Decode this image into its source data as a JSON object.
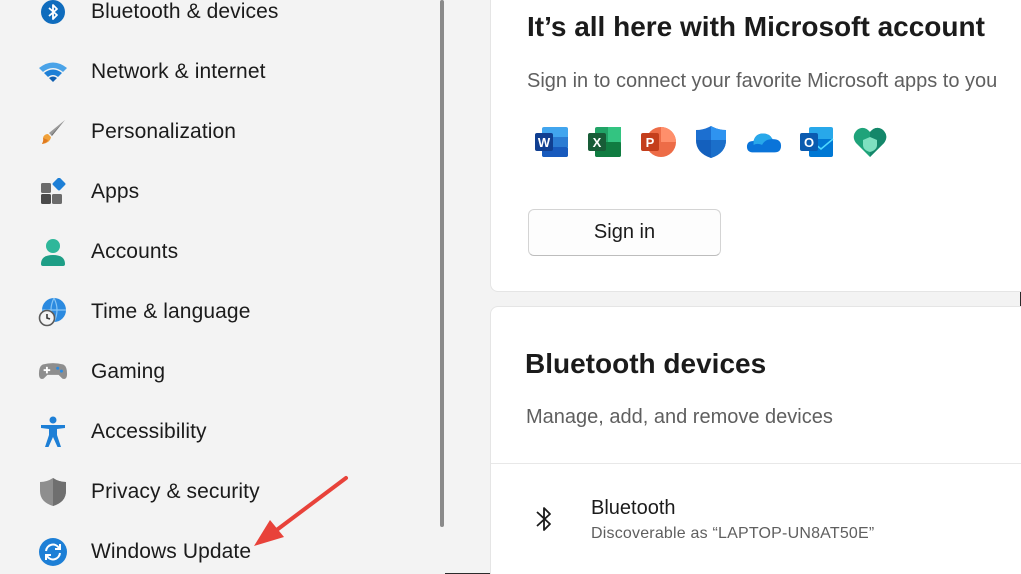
{
  "sidebar": {
    "items": [
      {
        "label": "Bluetooth & devices",
        "icon": "bluetooth-icon"
      },
      {
        "label": "Network & internet",
        "icon": "wifi-icon"
      },
      {
        "label": "Personalization",
        "icon": "brush-icon"
      },
      {
        "label": "Apps",
        "icon": "apps-icon"
      },
      {
        "label": "Accounts",
        "icon": "person-icon"
      },
      {
        "label": "Time & language",
        "icon": "globe-clock-icon"
      },
      {
        "label": "Gaming",
        "icon": "gamepad-icon"
      },
      {
        "label": "Accessibility",
        "icon": "accessibility-icon"
      },
      {
        "label": "Privacy & security",
        "icon": "shield-icon"
      },
      {
        "label": "Windows Update",
        "icon": "update-icon"
      }
    ]
  },
  "ms_account": {
    "title": "It’s all here with Microsoft account",
    "subtitle": "Sign in to connect your favorite Microsoft apps to you",
    "apps": [
      "word-icon",
      "excel-icon",
      "powerpoint-icon",
      "defender-icon",
      "onedrive-icon",
      "outlook-icon",
      "family-safety-icon"
    ],
    "signin_label": "Sign in"
  },
  "bluetooth_card": {
    "title": "Bluetooth devices",
    "subtitle": "Manage, add, and remove devices",
    "row_name": "Bluetooth",
    "row_desc": "Discoverable as “LAPTOP-UN8AT50E”"
  },
  "colors": {
    "accent": "#0067c0",
    "annotation_arrow": "#e8423a"
  }
}
